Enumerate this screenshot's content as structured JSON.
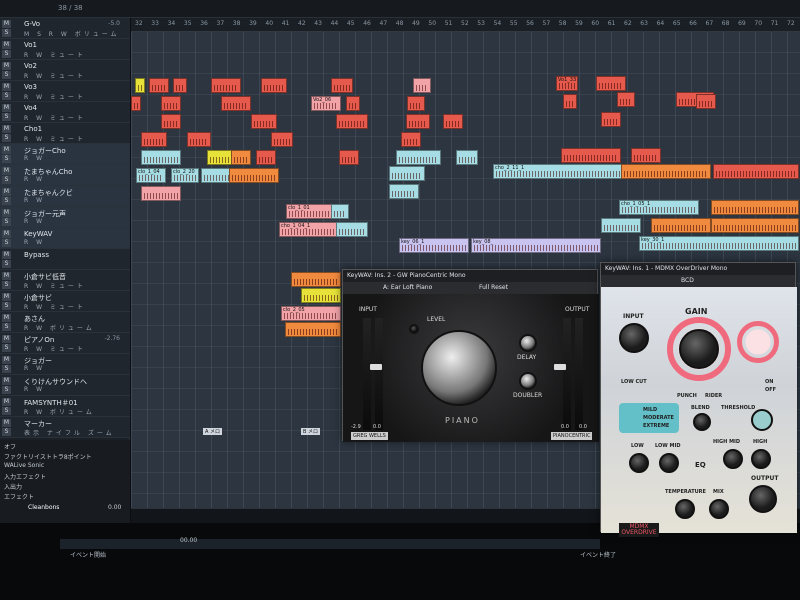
{
  "ruler": {
    "ticks": [
      "32",
      "33",
      "34",
      "35",
      "36",
      "37",
      "38",
      "39",
      "40",
      "41",
      "42",
      "43",
      "44",
      "45",
      "46",
      "47",
      "48",
      "49",
      "50",
      "51",
      "52",
      "53",
      "54",
      "55",
      "56",
      "57",
      "58",
      "59",
      "60",
      "61",
      "62",
      "63",
      "64",
      "65",
      "66",
      "67",
      "68",
      "69",
      "70",
      "71",
      "72"
    ]
  },
  "counter": "38 / 38",
  "tracks": [
    {
      "name": "G-Vo",
      "vol": "-5.0",
      "btns": "M S R W ボリューム"
    },
    {
      "name": "Vo1",
      "vol": "",
      "btns": "R W ミュート"
    },
    {
      "name": "Vo2",
      "vol": "",
      "btns": "R W ミュート"
    },
    {
      "name": "Vo3",
      "vol": "",
      "btns": "R W ミュート"
    },
    {
      "name": "Vo4",
      "vol": "",
      "btns": "R W ミュート"
    },
    {
      "name": "Cho1",
      "vol": "",
      "btns": "R W ミュート"
    },
    {
      "name": "ジョガーCho",
      "vol": "",
      "btns": "R W"
    },
    {
      "name": "たまちゃんCho",
      "vol": "",
      "btns": "R W"
    },
    {
      "name": "たまちゃんクビ",
      "vol": "",
      "btns": "R W"
    },
    {
      "name": "ジョガー元声",
      "vol": "",
      "btns": "R W"
    },
    {
      "name": "KeyWAV",
      "vol": "",
      "btns": "R W"
    },
    {
      "name": "Bypass",
      "vol": "",
      "btns": ""
    },
    {
      "name": "小倉サビ低音",
      "vol": "",
      "btns": "R W ミュート"
    },
    {
      "name": "小倉サビ",
      "vol": "",
      "btns": "R W ミュート"
    },
    {
      "name": "あさん",
      "vol": "",
      "btns": "R W ボリューム"
    },
    {
      "name": "ピアノOn",
      "vol": "-2.76",
      "btns": "R W ミュート"
    },
    {
      "name": "ジョガー",
      "vol": "",
      "btns": "R W"
    },
    {
      "name": "くりけんサウンドへ",
      "vol": "",
      "btns": "R W"
    },
    {
      "name": "FAMSYNTH＃01",
      "vol": "",
      "btns": "R W ボリューム"
    },
    {
      "name": "マーカー",
      "vol": "",
      "btns": "表示 ナイフル ズーム"
    }
  ],
  "bottom_left": [
    "オフ",
    "ファクトリイストトラ8ポイント",
    "WALive Sonic",
    "入力エフェクト",
    "入出力",
    "エフェクト",
    "Cleanbons"
  ],
  "bottom_left_vol": "0.00",
  "clips": [
    "Vo1_33",
    "Vo2_06",
    "clo_1_04",
    "clo_2_20",
    "cho_1_05_1",
    "key_06_1",
    "cho_1_04_1",
    "clo_1_01",
    "cho_2_11_1",
    "key_08_",
    "key_30_1",
    "clo_2_05"
  ],
  "markers": [
    "A メロ",
    "B メロ"
  ],
  "lower": {
    "labels": [
      "イベント開始",
      "イベント終了"
    ],
    "num": "00.00"
  },
  "piano": {
    "title": "KeyWAV: Ins. 2 - GW PianoCentric Mono",
    "preset": "A: Ear Loft Piano",
    "reset": "Full Reset",
    "labels": {
      "input": "INPUT",
      "output": "OUTPUT",
      "level": "LEVEL",
      "delay": "DELAY",
      "doubler": "DOUBLER",
      "name": "PIANO",
      "sig": "GREG WELLS",
      "brand": "PIANOCENTRIC"
    },
    "meter_left": "-2.9",
    "meter_left2": "0.0",
    "meter_right": "0.0",
    "meter_right2": "0.0"
  },
  "od": {
    "title": "KeyWAV: Ins. 1 - MDMX OverDriver Mono",
    "preset": "BCD",
    "labels": {
      "input": "INPUT",
      "gain": "GAIN",
      "low_cut": "LOW CUT",
      "punch": "PUNCH",
      "rider": "RIDER",
      "blend": "BLEND",
      "threshold": "THRESHOLD",
      "mild": "MILD",
      "moderate": "MODERATE",
      "extreme": "EXTREME",
      "low": "LOW",
      "low_mid": "LOW MID",
      "high_mid": "HIGH MID",
      "high": "HIGH",
      "eq": "EQ",
      "output": "OUTPUT",
      "temperature": "TEMPERATURE",
      "mix": "MIX",
      "brand": "MDMX",
      "name": "OVERDRIVE",
      "on": "ON",
      "off": "OFF"
    }
  }
}
